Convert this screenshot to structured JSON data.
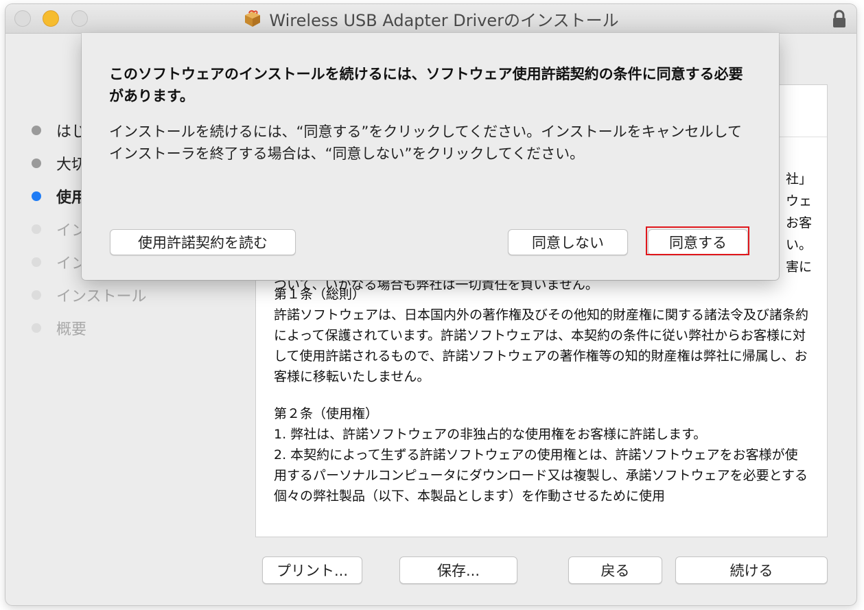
{
  "window": {
    "title": "Wireless USB Adapter Driverのインストール",
    "icons": {
      "package": "package-icon",
      "lock": "lock-icon"
    },
    "accent_color": "#1f7cf5",
    "highlight_color": "#e0161b"
  },
  "sidebar": {
    "steps": [
      {
        "label": "はじめに",
        "state": "done"
      },
      {
        "label": "大切な情報",
        "state": "done"
      },
      {
        "label": "使用許諾契約",
        "state": "active"
      },
      {
        "label": "インストール先",
        "state": "pending"
      },
      {
        "label": "インストールの種類",
        "state": "pending"
      },
      {
        "label": "インストール",
        "state": "pending"
      },
      {
        "label": "概要",
        "state": "pending"
      }
    ]
  },
  "license": {
    "peek_right": [
      "社」",
      "ウェ",
      "お客",
      "い。",
      "害に"
    ],
    "peek_line": "ついて、いかなる場合も弊社は一切責任を負いません。",
    "article1_title": "第１条（総則）",
    "article1_body": "許諾ソフトウェアは、日本国内外の著作権及びその他知的財産権に関する諸法令及び諸条約によって保護されています。許諾ソフトウェアは、本契約の条件に従い弊社からお客様に対して使用許諾されるもので、許諾ソフトウェアの著作権等の知的財産権は弊社に帰属し、お客様に移転いたしません。",
    "article2_title": "第２条（使用権）",
    "article2_item1": "1. 弊社は、許諾ソフトウェアの非独占的な使用権をお客様に許諾します。",
    "article2_item2": "2. 本契約によって生ずる許諾ソフトウェアの使用権とは、許諾ソフトウェアをお客様が使用するパーソナルコンピュータにダウンロード又は複製し、承諾ソフトウェアを必要とする個々の弊社製品（以下、本製品とします）を作動させるために使用"
  },
  "footer": {
    "print_label": "プリント...",
    "save_label": "保存...",
    "back_label": "戻る",
    "continue_label": "続ける"
  },
  "sheet": {
    "heading": "このソフトウェアのインストールを続けるには、ソフトウェア使用許諾契約の条件に同意する必要があります。",
    "body": "インストールを続けるには、“同意する”をクリックしてください。インストールをキャンセルしてインストーラを終了する場合は、“同意しない”をクリックしてください。",
    "read_label": "使用許諾契約を読む",
    "disagree_label": "同意しない",
    "agree_label": "同意する"
  }
}
